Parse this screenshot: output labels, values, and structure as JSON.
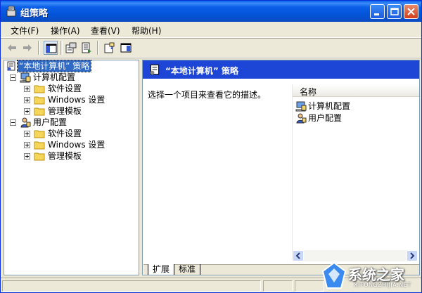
{
  "window": {
    "title": "组策略"
  },
  "menu": [
    {
      "label": "文件(F)"
    },
    {
      "label": "操作(A)"
    },
    {
      "label": "查看(V)"
    },
    {
      "label": "帮助(H)"
    }
  ],
  "tree": {
    "root": "“本地计算机” 策略",
    "computer": "计算机配置",
    "computer_children": [
      "软件设置",
      "Windows 设置",
      "管理模板"
    ],
    "user": "用户配置",
    "user_children": [
      "软件设置",
      "Windows 设置",
      "管理模板"
    ]
  },
  "right": {
    "banner_title": "“本地计算机” 策略",
    "description": "选择一个项目来查看它的描述。",
    "column_name": "名称",
    "items": [
      "计算机配置",
      "用户配置"
    ]
  },
  "tabs": [
    "扩展",
    "标准"
  ],
  "watermark": {
    "text": "系统之家",
    "sub": "XITONGZHIJIA.NET"
  },
  "colors": {
    "selection": "#316AC5",
    "banner": "#1E46D6",
    "titlebar": "#0A5FE8"
  }
}
